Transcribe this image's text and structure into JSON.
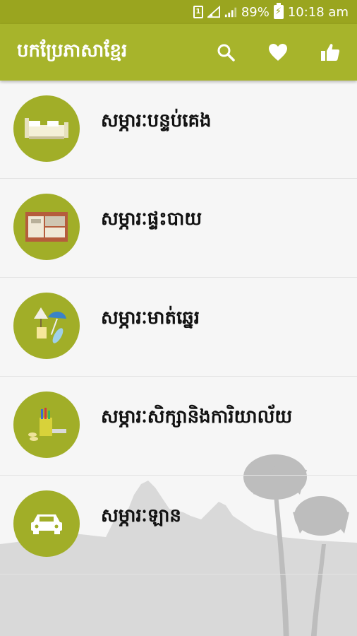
{
  "status_bar": {
    "battery": "89%",
    "time": "10:18 am",
    "sim_label": "1"
  },
  "toolbar": {
    "title": "បកប្រែភាសាខ្មែរ",
    "icons": [
      "search-icon",
      "heart-icon",
      "thumbs-up-icon"
    ]
  },
  "categories": [
    {
      "label": "សម្ភារៈបន្ទប់គេង",
      "icon": "bed-icon"
    },
    {
      "label": "សម្ភារៈផ្ទះបាយ",
      "icon": "kitchen-icon"
    },
    {
      "label": "សម្ភារៈមាត់ឆ្នេរ",
      "icon": "beach-icon"
    },
    {
      "label": "សម្ភារៈសិក្សានិងការិយាល័យ",
      "icon": "stationery-icon"
    },
    {
      "label": "សម្ភារៈឡាន",
      "icon": "car-icon"
    }
  ],
  "colors": {
    "status_bar": "#9aa51f",
    "toolbar": "#a7b42b",
    "accent": "#a1ae28"
  }
}
